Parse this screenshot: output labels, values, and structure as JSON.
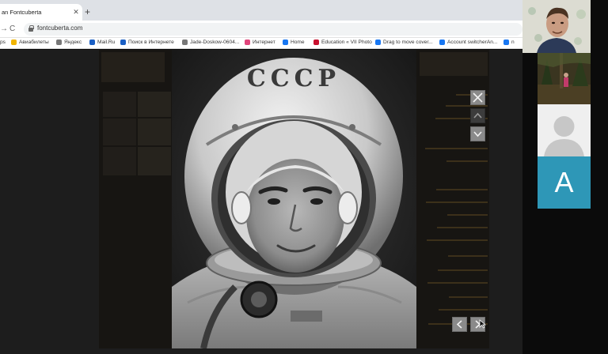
{
  "browser": {
    "tab_title": "an Fontcuberta",
    "tab_close": "✕",
    "new_tab": "+",
    "url": "fontcuberta.com",
    "back_glyph": "→",
    "reload_glyph": "C"
  },
  "bookmarks": [
    {
      "label": "ps",
      "icon": "apps-icon",
      "color": "#ffffff"
    },
    {
      "label": "Авиабилеты",
      "icon": "plane-icon",
      "color": "#f0b400"
    },
    {
      "label": "Яндекс",
      "icon": "globe-icon",
      "color": "#777777"
    },
    {
      "label": "Mail.Ru",
      "icon": "mail-icon",
      "color": "#1a5fc4"
    },
    {
      "label": "Поиск в Интернете",
      "icon": "search-icon",
      "color": "#1a5fc4"
    },
    {
      "label": "Jade-Doskow-0604...",
      "icon": "globe-icon",
      "color": "#777777"
    },
    {
      "label": "Интернет",
      "icon": "folder-icon",
      "color": "#e0457b"
    },
    {
      "label": "Home",
      "icon": "facebook-icon",
      "color": "#1877f2"
    },
    {
      "label": "Education « VII Photo",
      "icon": "vii-icon",
      "color": "#c8102e"
    },
    {
      "label": "Drag to move cover...",
      "icon": "facebook-icon",
      "color": "#1877f2"
    },
    {
      "label": "Account switcherAn...",
      "icon": "facebook-icon",
      "color": "#1877f2"
    },
    {
      "label": "n",
      "icon": "facebook-icon",
      "color": "#1877f2"
    }
  ],
  "photo": {
    "helmet_lettering": "СССР"
  },
  "background_menu": [
    "",
    "",
    "",
    "",
    "",
    "",
    "",
    "",
    "",
    "",
    "",
    "",
    "",
    "",
    "",
    ""
  ],
  "lightbox": {
    "close": "close-icon",
    "prev_up": "chevron-up-icon",
    "next_down": "chevron-down-icon",
    "prev": "chevron-left-icon",
    "next": "chevron-right-icon"
  },
  "call": {
    "participant_letter": "A"
  },
  "colors": {
    "accent_tile": "#2e97b7",
    "page_bg": "#1d1d1d"
  }
}
